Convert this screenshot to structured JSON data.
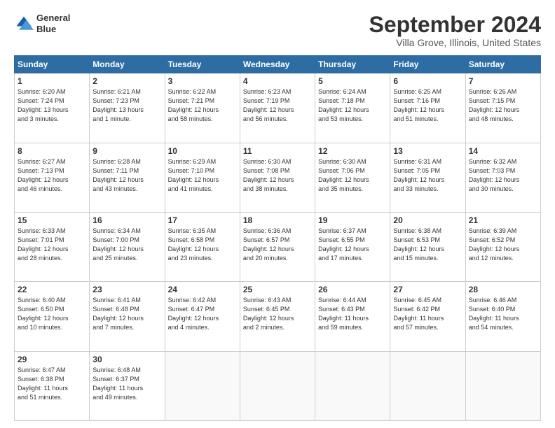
{
  "logo": {
    "line1": "General",
    "line2": "Blue"
  },
  "title": "September 2024",
  "subtitle": "Villa Grove, Illinois, United States",
  "days_of_week": [
    "Sunday",
    "Monday",
    "Tuesday",
    "Wednesday",
    "Thursday",
    "Friday",
    "Saturday"
  ],
  "weeks": [
    [
      {
        "day": 1,
        "info": "Sunrise: 6:20 AM\nSunset: 7:24 PM\nDaylight: 13 hours\nand 3 minutes."
      },
      {
        "day": 2,
        "info": "Sunrise: 6:21 AM\nSunset: 7:23 PM\nDaylight: 13 hours\nand 1 minute."
      },
      {
        "day": 3,
        "info": "Sunrise: 6:22 AM\nSunset: 7:21 PM\nDaylight: 12 hours\nand 58 minutes."
      },
      {
        "day": 4,
        "info": "Sunrise: 6:23 AM\nSunset: 7:19 PM\nDaylight: 12 hours\nand 56 minutes."
      },
      {
        "day": 5,
        "info": "Sunrise: 6:24 AM\nSunset: 7:18 PM\nDaylight: 12 hours\nand 53 minutes."
      },
      {
        "day": 6,
        "info": "Sunrise: 6:25 AM\nSunset: 7:16 PM\nDaylight: 12 hours\nand 51 minutes."
      },
      {
        "day": 7,
        "info": "Sunrise: 6:26 AM\nSunset: 7:15 PM\nDaylight: 12 hours\nand 48 minutes."
      }
    ],
    [
      {
        "day": 8,
        "info": "Sunrise: 6:27 AM\nSunset: 7:13 PM\nDaylight: 12 hours\nand 46 minutes."
      },
      {
        "day": 9,
        "info": "Sunrise: 6:28 AM\nSunset: 7:11 PM\nDaylight: 12 hours\nand 43 minutes."
      },
      {
        "day": 10,
        "info": "Sunrise: 6:29 AM\nSunset: 7:10 PM\nDaylight: 12 hours\nand 41 minutes."
      },
      {
        "day": 11,
        "info": "Sunrise: 6:30 AM\nSunset: 7:08 PM\nDaylight: 12 hours\nand 38 minutes."
      },
      {
        "day": 12,
        "info": "Sunrise: 6:30 AM\nSunset: 7:06 PM\nDaylight: 12 hours\nand 35 minutes."
      },
      {
        "day": 13,
        "info": "Sunrise: 6:31 AM\nSunset: 7:05 PM\nDaylight: 12 hours\nand 33 minutes."
      },
      {
        "day": 14,
        "info": "Sunrise: 6:32 AM\nSunset: 7:03 PM\nDaylight: 12 hours\nand 30 minutes."
      }
    ],
    [
      {
        "day": 15,
        "info": "Sunrise: 6:33 AM\nSunset: 7:01 PM\nDaylight: 12 hours\nand 28 minutes."
      },
      {
        "day": 16,
        "info": "Sunrise: 6:34 AM\nSunset: 7:00 PM\nDaylight: 12 hours\nand 25 minutes."
      },
      {
        "day": 17,
        "info": "Sunrise: 6:35 AM\nSunset: 6:58 PM\nDaylight: 12 hours\nand 23 minutes."
      },
      {
        "day": 18,
        "info": "Sunrise: 6:36 AM\nSunset: 6:57 PM\nDaylight: 12 hours\nand 20 minutes."
      },
      {
        "day": 19,
        "info": "Sunrise: 6:37 AM\nSunset: 6:55 PM\nDaylight: 12 hours\nand 17 minutes."
      },
      {
        "day": 20,
        "info": "Sunrise: 6:38 AM\nSunset: 6:53 PM\nDaylight: 12 hours\nand 15 minutes."
      },
      {
        "day": 21,
        "info": "Sunrise: 6:39 AM\nSunset: 6:52 PM\nDaylight: 12 hours\nand 12 minutes."
      }
    ],
    [
      {
        "day": 22,
        "info": "Sunrise: 6:40 AM\nSunset: 6:50 PM\nDaylight: 12 hours\nand 10 minutes."
      },
      {
        "day": 23,
        "info": "Sunrise: 6:41 AM\nSunset: 6:48 PM\nDaylight: 12 hours\nand 7 minutes."
      },
      {
        "day": 24,
        "info": "Sunrise: 6:42 AM\nSunset: 6:47 PM\nDaylight: 12 hours\nand 4 minutes."
      },
      {
        "day": 25,
        "info": "Sunrise: 6:43 AM\nSunset: 6:45 PM\nDaylight: 12 hours\nand 2 minutes."
      },
      {
        "day": 26,
        "info": "Sunrise: 6:44 AM\nSunset: 6:43 PM\nDaylight: 11 hours\nand 59 minutes."
      },
      {
        "day": 27,
        "info": "Sunrise: 6:45 AM\nSunset: 6:42 PM\nDaylight: 11 hours\nand 57 minutes."
      },
      {
        "day": 28,
        "info": "Sunrise: 6:46 AM\nSunset: 6:40 PM\nDaylight: 11 hours\nand 54 minutes."
      }
    ],
    [
      {
        "day": 29,
        "info": "Sunrise: 6:47 AM\nSunset: 6:38 PM\nDaylight: 11 hours\nand 51 minutes."
      },
      {
        "day": 30,
        "info": "Sunrise: 6:48 AM\nSunset: 6:37 PM\nDaylight: 11 hours\nand 49 minutes."
      },
      null,
      null,
      null,
      null,
      null
    ]
  ]
}
